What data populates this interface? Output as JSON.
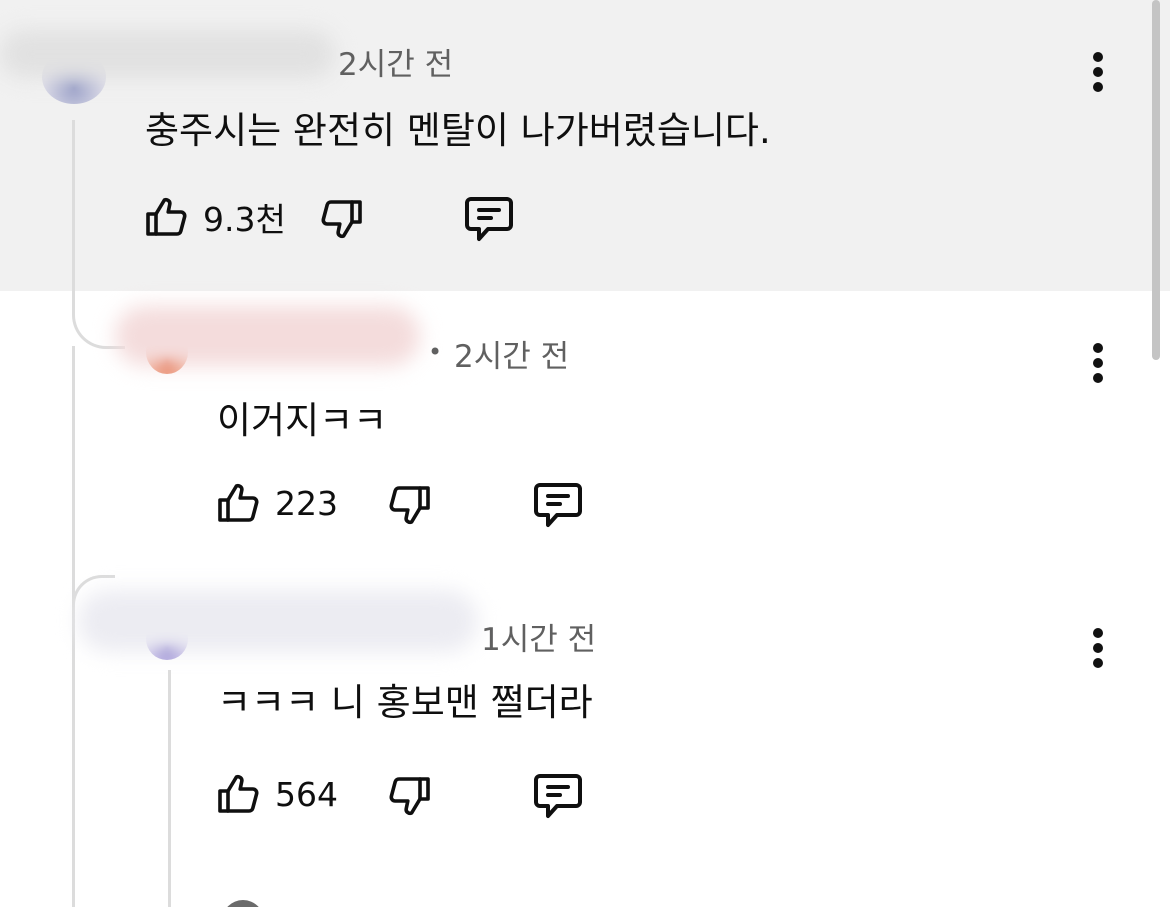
{
  "comments": [
    {
      "time": "2시간 전",
      "text": "충주시는 완전히 멘탈이 나가버렸습니다.",
      "likes": "9.3천"
    },
    {
      "separator": "•",
      "time": "2시간 전",
      "text": "이거지ㅋㅋ",
      "likes": "223"
    },
    {
      "time": "1시간 전",
      "text": "ㅋㅋㅋ 니 홍보맨 쩔더라",
      "likes": "564"
    }
  ],
  "icons": {
    "like": "thumbs-up-icon",
    "dislike": "thumbs-down-icon",
    "reply": "comment-reply-icon",
    "menu": "more-vert-icon"
  },
  "colors": {
    "highlight_background": "#f1f1f1",
    "meta_text": "#606060",
    "thread_line": "#dcdcdc"
  }
}
